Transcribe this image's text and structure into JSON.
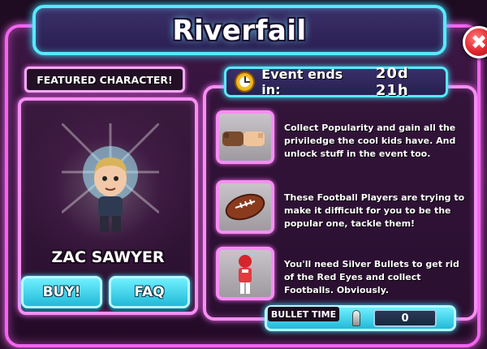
{
  "title": "Riverfail",
  "close_label": "✖",
  "featured": {
    "label": "FEATURED CHARACTER!",
    "character_name": "ZAC SAWYER",
    "buy_label": "BUY!",
    "faq_label": "FAQ"
  },
  "event": {
    "label": "Event ends in:",
    "time_remaining": "20d 21h"
  },
  "info": [
    {
      "icon": "fist-bump-icon",
      "text": "Collect Popularity and gain all the priviledge the cool kids have. And unlock stuff in the event too."
    },
    {
      "icon": "football-icon",
      "text": "These Football Players are trying to make it difficult for you to be the popular one, tackle them!"
    },
    {
      "icon": "football-player-icon",
      "text": "You'll need Silver Bullets to get rid of the Red Eyes and collect Footballs. Obviously."
    }
  ],
  "bullet_time": {
    "label": "BULLET TIME",
    "value": "0"
  },
  "colors": {
    "neon_pink": "#f58ff2",
    "neon_cyan": "#57e9ff",
    "close_red": "#e2262e"
  }
}
